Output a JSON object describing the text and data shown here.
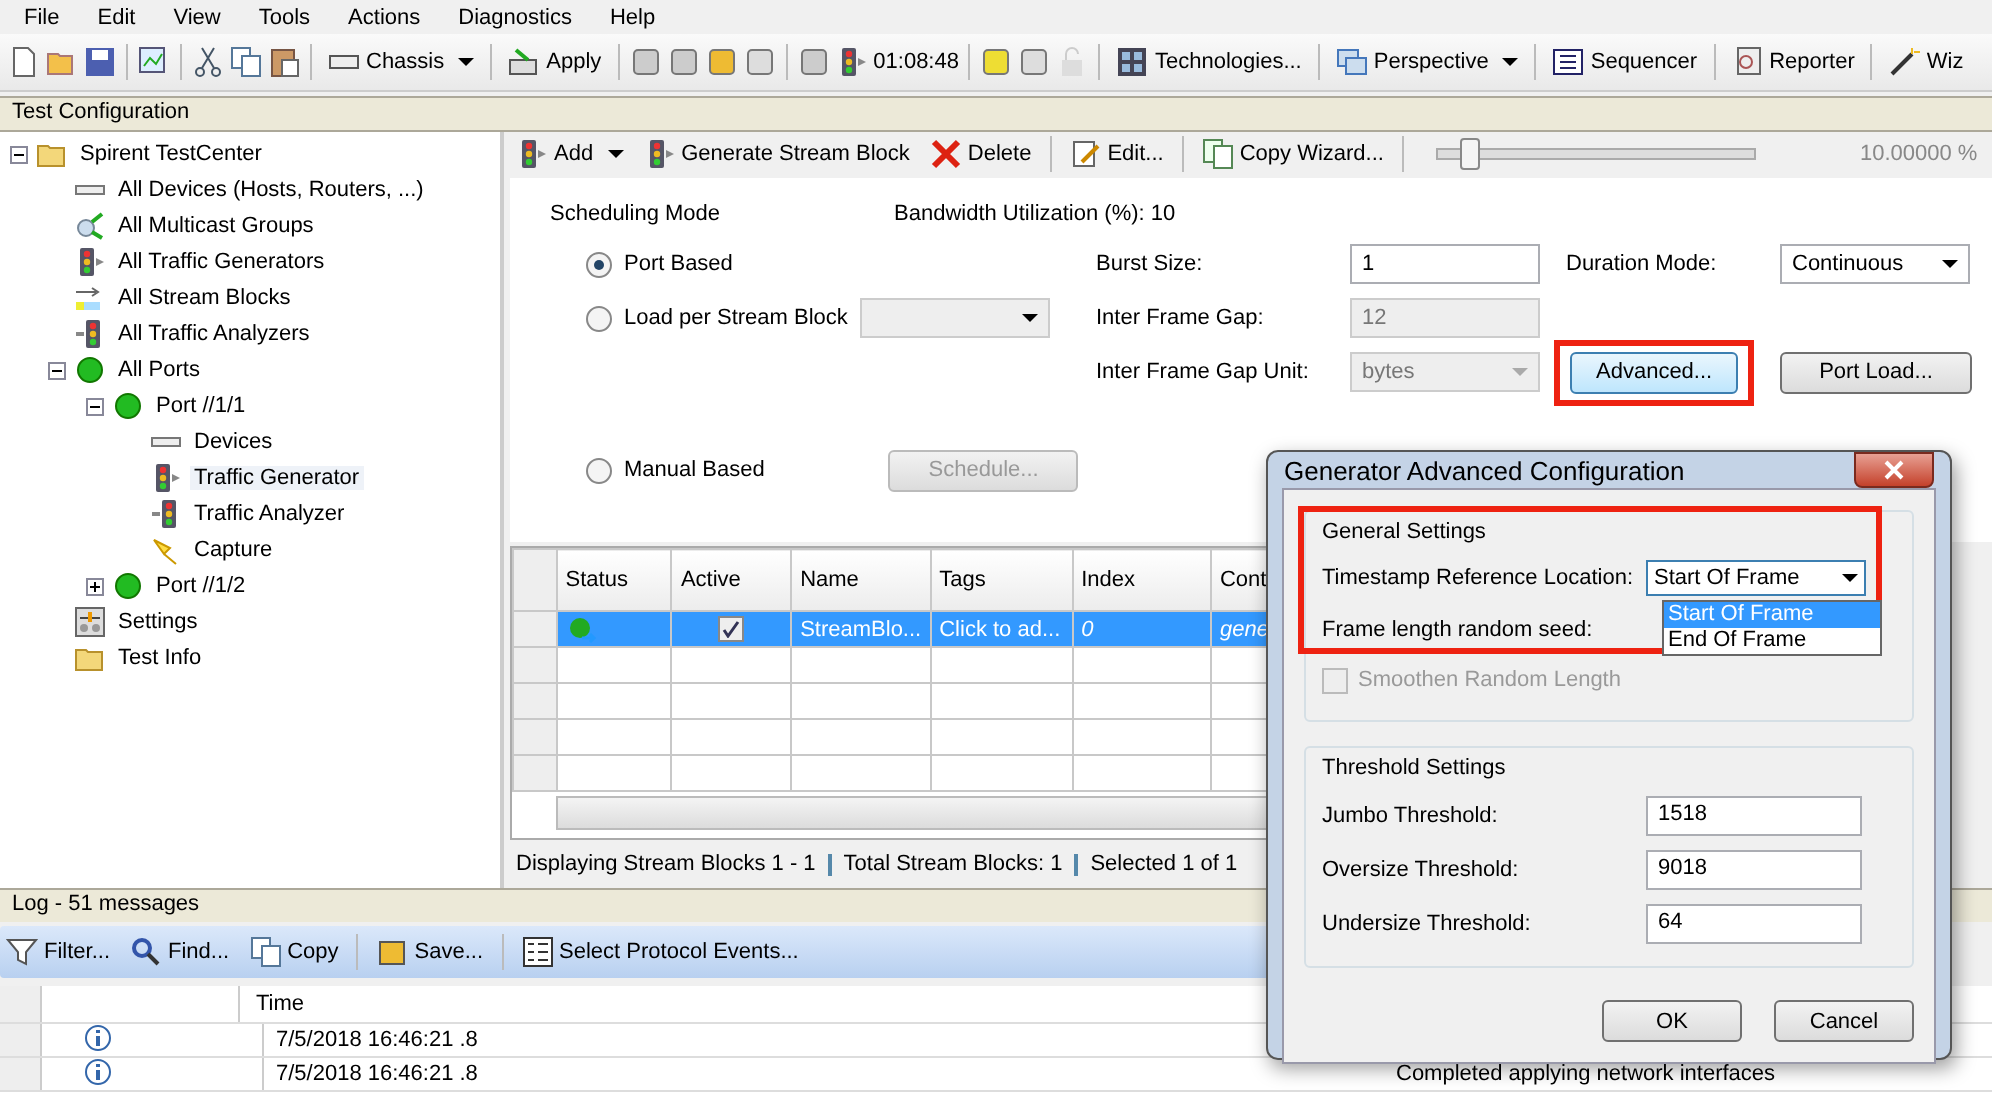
{
  "menu": [
    {
      "label": "File"
    },
    {
      "label": "Edit"
    },
    {
      "label": "View"
    },
    {
      "label": "Tools"
    },
    {
      "label": "Actions"
    },
    {
      "label": "Diagnostics"
    },
    {
      "label": "Help"
    }
  ],
  "toolbar": {
    "chassis": "Chassis",
    "apply": "Apply",
    "time": "01:08:48",
    "technologies": "Technologies...",
    "perspective": "Perspective",
    "sequencer": "Sequencer",
    "reporter": "Reporter",
    "wizard": "Wiz"
  },
  "panel_title": "Test Configuration",
  "tree": [
    {
      "label": "Spirent TestCenter",
      "kind": "folder",
      "selected": false,
      "expanded": true,
      "children": [
        {
          "label": "All Devices (Hosts, Routers, ...)",
          "kind": "device",
          "selected": false
        },
        {
          "label": "All Multicast Groups",
          "kind": "multicast",
          "selected": false
        },
        {
          "label": "All Traffic Generators",
          "kind": "generator",
          "selected": false
        },
        {
          "label": "All Stream Blocks",
          "kind": "streams",
          "selected": false
        },
        {
          "label": "All Traffic Analyzers",
          "kind": "analyzer",
          "selected": false
        },
        {
          "label": "All Ports",
          "kind": "port",
          "selected": false,
          "expanded": true,
          "children": [
            {
              "label": "Port //1/1",
              "kind": "port",
              "selected": false,
              "expanded": true,
              "children": [
                {
                  "label": "Devices",
                  "kind": "device",
                  "selected": false
                },
                {
                  "label": "Traffic Generator",
                  "kind": "generator",
                  "selected": true
                },
                {
                  "label": "Traffic Analyzer",
                  "kind": "analyzer",
                  "selected": false
                },
                {
                  "label": "Capture",
                  "kind": "capture",
                  "selected": false
                }
              ]
            },
            {
              "label": "Port //1/2",
              "kind": "port",
              "selected": false,
              "expanded": false
            }
          ]
        },
        {
          "label": "Settings",
          "kind": "settings",
          "selected": false
        },
        {
          "label": "Test Info",
          "kind": "folder",
          "selected": false
        }
      ]
    }
  ],
  "stream_toolbar": {
    "add": "Add",
    "generate": "Generate Stream Block",
    "delete": "Delete",
    "edit": "Edit...",
    "copy_wizard": "Copy Wizard...",
    "slider": {
      "level": 0.1
    },
    "reading": "10.00000 %"
  },
  "scheduling": {
    "title": "Scheduling Mode",
    "bandwidth": "Bandwidth Utilization (%): 10",
    "modes": [
      {
        "label": "Port Based",
        "selected": true
      },
      {
        "label": "Load per Stream Block",
        "selected": false
      },
      {
        "label": "Manual Based",
        "selected": false
      }
    ],
    "burst_size": {
      "label": "Burst Size:",
      "value": "1"
    },
    "inter_frame_gap": {
      "label": "Inter Frame Gap:",
      "value": "12",
      "disabled": true
    },
    "gap_unit": {
      "label": "Inter Frame Gap Unit:",
      "value": "bytes",
      "disabled": true
    },
    "duration_mode": {
      "label": "Duration Mode:",
      "value": "Continuous"
    },
    "advanced_button": "Advanced...",
    "port_load_button": "Port Load...",
    "schedule_button": "Schedule..."
  },
  "grid": {
    "columns": [
      "Status",
      "Active",
      "Name",
      "Tags",
      "Index",
      "Cont"
    ],
    "rows": [
      {
        "selected": true,
        "active": true,
        "name": "StreamBlo...",
        "tags": "Click to ad...",
        "index": "0",
        "column_6": "gene"
      }
    ],
    "status": [
      "Displaying Stream Blocks 1 - 1",
      "Total Stream Blocks: 1",
      "Selected 1 of 1"
    ]
  },
  "log": {
    "title": "Log - 51 messages",
    "toolbar": [
      "Filter...",
      "Find...",
      "Copy",
      "Save...",
      "Select Protocol Events..."
    ],
    "time_column": "Time",
    "rows": [
      {
        "time": "7/5/2018 16:46:21 .8",
        "message": ""
      },
      {
        "time": "7/5/2018 16:46:21 .8",
        "message": "Completed applying network interfaces"
      }
    ]
  },
  "dialog": {
    "title": "Generator Advanced Configuration",
    "general_title": "General Settings",
    "timestamp": {
      "label": "Timestamp Reference Location:",
      "value": "Start Of Frame",
      "options": [
        {
          "label": "Start Of Frame",
          "selected": true
        },
        {
          "label": "End Of Frame",
          "selected": false
        }
      ]
    },
    "seed_label": "Frame length random seed:",
    "smoothen": {
      "label": "Smoothen Random Length",
      "checked": false,
      "disabled": true
    },
    "threshold_title": "Threshold Settings",
    "thresholds": [
      {
        "label": "Jumbo Threshold:",
        "value": "1518"
      },
      {
        "label": "Oversize Threshold:",
        "value": "9018"
      },
      {
        "label": "Undersize Threshold:",
        "value": "64"
      }
    ],
    "ok": "OK",
    "cancel": "Cancel"
  }
}
